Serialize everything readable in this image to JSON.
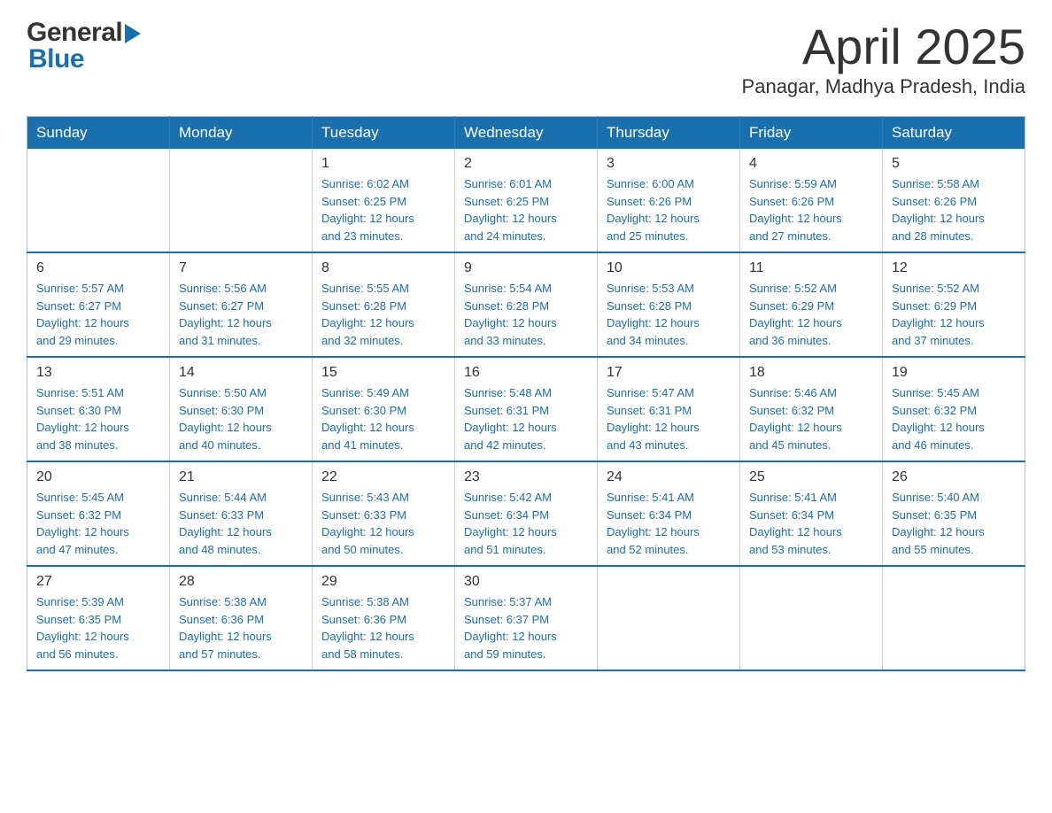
{
  "header": {
    "logo_general": "General",
    "logo_blue": "Blue",
    "month_title": "April 2025",
    "location": "Panagar, Madhya Pradesh, India"
  },
  "weekdays": [
    "Sunday",
    "Monday",
    "Tuesday",
    "Wednesday",
    "Thursday",
    "Friday",
    "Saturday"
  ],
  "weeks": [
    [
      {
        "day": "",
        "info": ""
      },
      {
        "day": "",
        "info": ""
      },
      {
        "day": "1",
        "info": "Sunrise: 6:02 AM\nSunset: 6:25 PM\nDaylight: 12 hours\nand 23 minutes."
      },
      {
        "day": "2",
        "info": "Sunrise: 6:01 AM\nSunset: 6:25 PM\nDaylight: 12 hours\nand 24 minutes."
      },
      {
        "day": "3",
        "info": "Sunrise: 6:00 AM\nSunset: 6:26 PM\nDaylight: 12 hours\nand 25 minutes."
      },
      {
        "day": "4",
        "info": "Sunrise: 5:59 AM\nSunset: 6:26 PM\nDaylight: 12 hours\nand 27 minutes."
      },
      {
        "day": "5",
        "info": "Sunrise: 5:58 AM\nSunset: 6:26 PM\nDaylight: 12 hours\nand 28 minutes."
      }
    ],
    [
      {
        "day": "6",
        "info": "Sunrise: 5:57 AM\nSunset: 6:27 PM\nDaylight: 12 hours\nand 29 minutes."
      },
      {
        "day": "7",
        "info": "Sunrise: 5:56 AM\nSunset: 6:27 PM\nDaylight: 12 hours\nand 31 minutes."
      },
      {
        "day": "8",
        "info": "Sunrise: 5:55 AM\nSunset: 6:28 PM\nDaylight: 12 hours\nand 32 minutes."
      },
      {
        "day": "9",
        "info": "Sunrise: 5:54 AM\nSunset: 6:28 PM\nDaylight: 12 hours\nand 33 minutes."
      },
      {
        "day": "10",
        "info": "Sunrise: 5:53 AM\nSunset: 6:28 PM\nDaylight: 12 hours\nand 34 minutes."
      },
      {
        "day": "11",
        "info": "Sunrise: 5:52 AM\nSunset: 6:29 PM\nDaylight: 12 hours\nand 36 minutes."
      },
      {
        "day": "12",
        "info": "Sunrise: 5:52 AM\nSunset: 6:29 PM\nDaylight: 12 hours\nand 37 minutes."
      }
    ],
    [
      {
        "day": "13",
        "info": "Sunrise: 5:51 AM\nSunset: 6:30 PM\nDaylight: 12 hours\nand 38 minutes."
      },
      {
        "day": "14",
        "info": "Sunrise: 5:50 AM\nSunset: 6:30 PM\nDaylight: 12 hours\nand 40 minutes."
      },
      {
        "day": "15",
        "info": "Sunrise: 5:49 AM\nSunset: 6:30 PM\nDaylight: 12 hours\nand 41 minutes."
      },
      {
        "day": "16",
        "info": "Sunrise: 5:48 AM\nSunset: 6:31 PM\nDaylight: 12 hours\nand 42 minutes."
      },
      {
        "day": "17",
        "info": "Sunrise: 5:47 AM\nSunset: 6:31 PM\nDaylight: 12 hours\nand 43 minutes."
      },
      {
        "day": "18",
        "info": "Sunrise: 5:46 AM\nSunset: 6:32 PM\nDaylight: 12 hours\nand 45 minutes."
      },
      {
        "day": "19",
        "info": "Sunrise: 5:45 AM\nSunset: 6:32 PM\nDaylight: 12 hours\nand 46 minutes."
      }
    ],
    [
      {
        "day": "20",
        "info": "Sunrise: 5:45 AM\nSunset: 6:32 PM\nDaylight: 12 hours\nand 47 minutes."
      },
      {
        "day": "21",
        "info": "Sunrise: 5:44 AM\nSunset: 6:33 PM\nDaylight: 12 hours\nand 48 minutes."
      },
      {
        "day": "22",
        "info": "Sunrise: 5:43 AM\nSunset: 6:33 PM\nDaylight: 12 hours\nand 50 minutes."
      },
      {
        "day": "23",
        "info": "Sunrise: 5:42 AM\nSunset: 6:34 PM\nDaylight: 12 hours\nand 51 minutes."
      },
      {
        "day": "24",
        "info": "Sunrise: 5:41 AM\nSunset: 6:34 PM\nDaylight: 12 hours\nand 52 minutes."
      },
      {
        "day": "25",
        "info": "Sunrise: 5:41 AM\nSunset: 6:34 PM\nDaylight: 12 hours\nand 53 minutes."
      },
      {
        "day": "26",
        "info": "Sunrise: 5:40 AM\nSunset: 6:35 PM\nDaylight: 12 hours\nand 55 minutes."
      }
    ],
    [
      {
        "day": "27",
        "info": "Sunrise: 5:39 AM\nSunset: 6:35 PM\nDaylight: 12 hours\nand 56 minutes."
      },
      {
        "day": "28",
        "info": "Sunrise: 5:38 AM\nSunset: 6:36 PM\nDaylight: 12 hours\nand 57 minutes."
      },
      {
        "day": "29",
        "info": "Sunrise: 5:38 AM\nSunset: 6:36 PM\nDaylight: 12 hours\nand 58 minutes."
      },
      {
        "day": "30",
        "info": "Sunrise: 5:37 AM\nSunset: 6:37 PM\nDaylight: 12 hours\nand 59 minutes."
      },
      {
        "day": "",
        "info": ""
      },
      {
        "day": "",
        "info": ""
      },
      {
        "day": "",
        "info": ""
      }
    ]
  ]
}
